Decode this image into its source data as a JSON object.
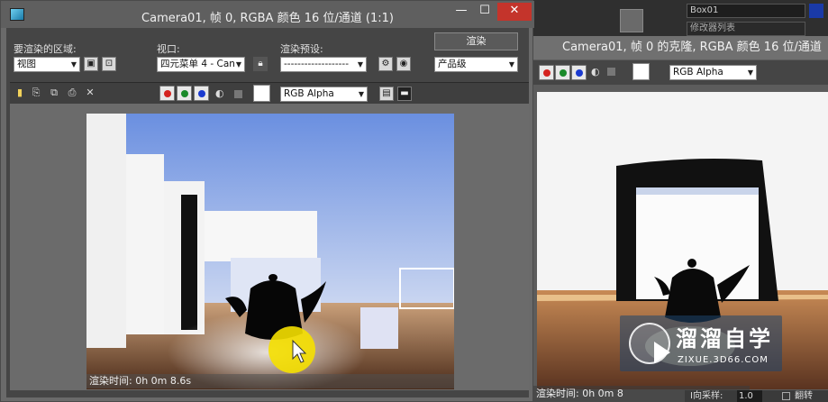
{
  "background_app": {
    "object_name_field": "Box01",
    "modifier_list_field": "修改器列表",
    "swatch_color": "#1a3aa8"
  },
  "window1": {
    "title": "Camera01, 帧 0, RGBA 颜色 16 位/通道 (1:1)",
    "min_label": "—",
    "max_label": "☐",
    "close_label": "✕",
    "area_label": "要渲染的区域:",
    "area_value": "视图",
    "viewport_label": "视口:",
    "viewport_value": "四元菜单 4 - Can",
    "preset_label": "渲染预设:",
    "preset_value": "-------------------",
    "render_button": "渲染",
    "quality_value": "产品级",
    "channel_value": "RGB Alpha",
    "render_time": "渲染时间: 0h 0m 8.6s"
  },
  "window2": {
    "title": "Camera01, 帧 0 的克隆, RGBA 颜色 16 位/通道",
    "channel_value": "RGB Alpha",
    "render_time": "渲染时间: 0h 0m 8"
  },
  "watermark": {
    "title": "溜溜自学",
    "url": "ZIXUE.3D66.COM"
  },
  "bottom_bar": {
    "label": "I向采样:",
    "value": "1.0",
    "toggle": "翻转"
  },
  "colors": {
    "channel_red": "#d4231f",
    "channel_green": "#1a8a2a",
    "channel_blue": "#1a3ad0",
    "close_button": "#c4342b",
    "cursor_highlight": "#f5e000"
  }
}
